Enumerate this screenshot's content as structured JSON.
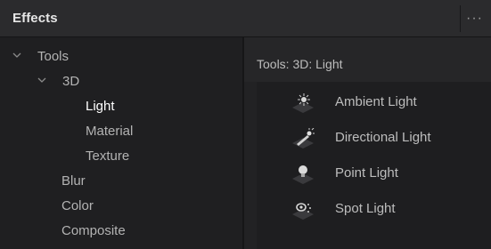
{
  "header": {
    "title": "Effects",
    "menu_label": "···"
  },
  "tree": {
    "items": [
      {
        "label": "Tools",
        "level": 0,
        "expanded": true
      },
      {
        "label": "3D",
        "level": 1,
        "expanded": true
      },
      {
        "label": "Light",
        "level": 2,
        "selected": true
      },
      {
        "label": "Material",
        "level": 2
      },
      {
        "label": "Texture",
        "level": 2
      },
      {
        "label": "Blur",
        "level": 1
      },
      {
        "label": "Color",
        "level": 1
      },
      {
        "label": "Composite",
        "level": 1
      }
    ]
  },
  "content": {
    "breadcrumb": "Tools: 3D: Light",
    "items": [
      {
        "label": "Ambient Light",
        "icon": "ambient-light-icon"
      },
      {
        "label": "Directional Light",
        "icon": "directional-light-icon"
      },
      {
        "label": "Point Light",
        "icon": "point-light-icon"
      },
      {
        "label": "Spot Light",
        "icon": "spot-light-icon"
      }
    ]
  },
  "colors": {
    "background": "#1f1f21",
    "header": "#2b2b2d",
    "selected_text": "#ffffff",
    "text": "#b3b3b3"
  }
}
